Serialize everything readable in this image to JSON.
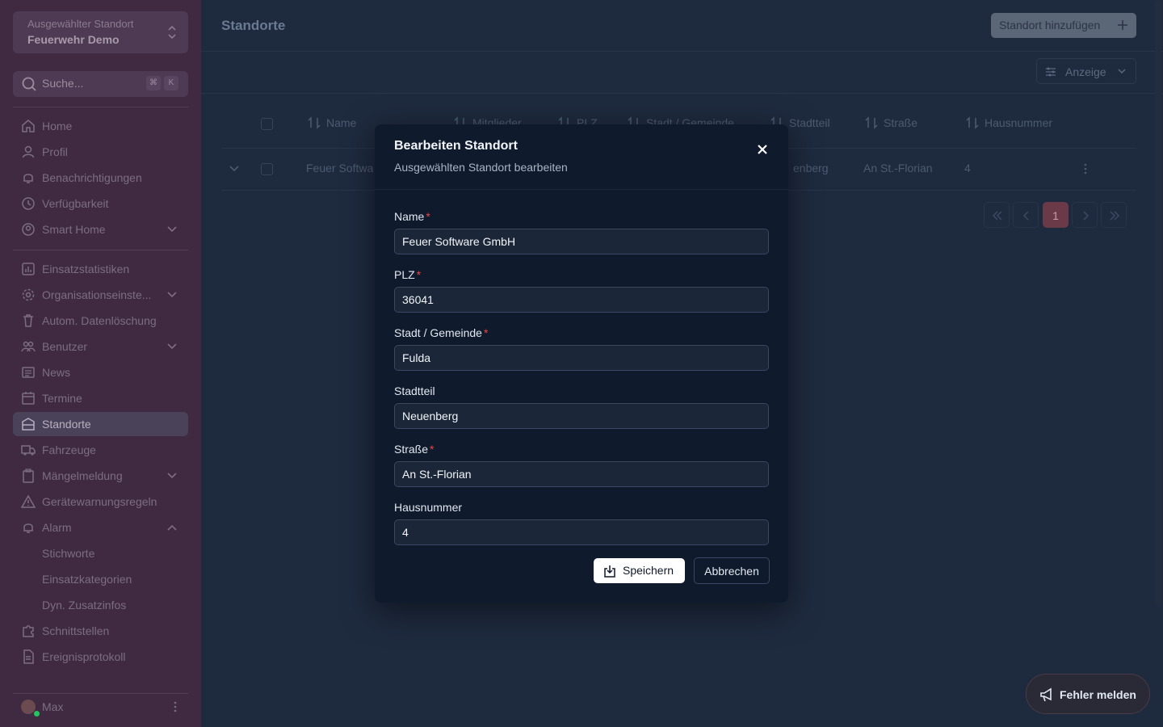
{
  "sidebar": {
    "location_caption": "Ausgewählter Standort",
    "location_value": "Feuerwehr Demo",
    "search_placeholder": "Suche...",
    "search_kbd": [
      "⌘",
      "K"
    ],
    "items": [
      {
        "label": "Home",
        "icon": "home-icon"
      },
      {
        "label": "Profil",
        "icon": "user-icon"
      },
      {
        "label": "Benachrichtigungen",
        "icon": "bell-icon"
      },
      {
        "label": "Verfügbarkeit",
        "icon": "clock-icon"
      },
      {
        "label": "Smart Home",
        "icon": "user-circle-icon"
      },
      {
        "label": "Einsatzstatistiken",
        "icon": "chart-icon"
      },
      {
        "label": "Organisationseinste...",
        "icon": "gear-icon"
      },
      {
        "label": "Autom. Datenlöschung",
        "icon": "trash-icon"
      },
      {
        "label": "Benutzer",
        "icon": "users-icon"
      },
      {
        "label": "News",
        "icon": "news-icon"
      },
      {
        "label": "Termine",
        "icon": "calendar-icon"
      },
      {
        "label": "Standorte",
        "icon": "building-icon"
      },
      {
        "label": "Fahrzeuge",
        "icon": "truck-icon"
      },
      {
        "label": "Mängelmeldung",
        "icon": "clipboard-icon"
      },
      {
        "label": "Gerätewarnungsregeln",
        "icon": "warning-icon"
      },
      {
        "label": "Alarm",
        "icon": "bell-icon"
      },
      {
        "label": "Stichworte"
      },
      {
        "label": "Einsatzkategorien"
      },
      {
        "label": "Dyn. Zusatzinfos"
      },
      {
        "label": "Schnittstellen",
        "icon": "puzzle-icon"
      },
      {
        "label": "Ereignisprotokoll",
        "icon": "document-icon"
      }
    ],
    "user_name": "Max"
  },
  "main": {
    "title": "Standorte",
    "add_button": "Standort hinzufügen",
    "display_button": "Anzeige",
    "table": {
      "columns": [
        "Name",
        "Mitglieder",
        "PLZ",
        "Stadt / Gemeinde",
        "Stadtteil",
        "Straße",
        "Hausnummer"
      ],
      "row": {
        "name": "Feuer Softwa",
        "stadtteil": "enberg",
        "strasse": "An St.-Florian",
        "hausnummer": "4"
      }
    },
    "pagination": {
      "current_page": "1"
    }
  },
  "modal": {
    "title": "Bearbeiten Standort",
    "subtitle": "Ausgewählten Standort bearbeiten",
    "fields": [
      {
        "label": "Name",
        "required": true,
        "value": "Feuer Software GmbH"
      },
      {
        "label": "PLZ",
        "required": true,
        "value": "36041"
      },
      {
        "label": "Stadt / Gemeinde",
        "required": true,
        "value": "Fulda"
      },
      {
        "label": "Stadtteil",
        "required": false,
        "value": "Neuenberg"
      },
      {
        "label": "Straße",
        "required": true,
        "value": "An St.-Florian"
      },
      {
        "label": "Hausnummer",
        "required": false,
        "value": "4"
      }
    ],
    "required_mark": "*",
    "save_button": "Speichern",
    "cancel_button": "Abbrechen"
  },
  "error_button": "Fehler melden",
  "colors": {
    "accent": "#6a3a48",
    "required": "#ef4444",
    "online": "#22c55e"
  }
}
